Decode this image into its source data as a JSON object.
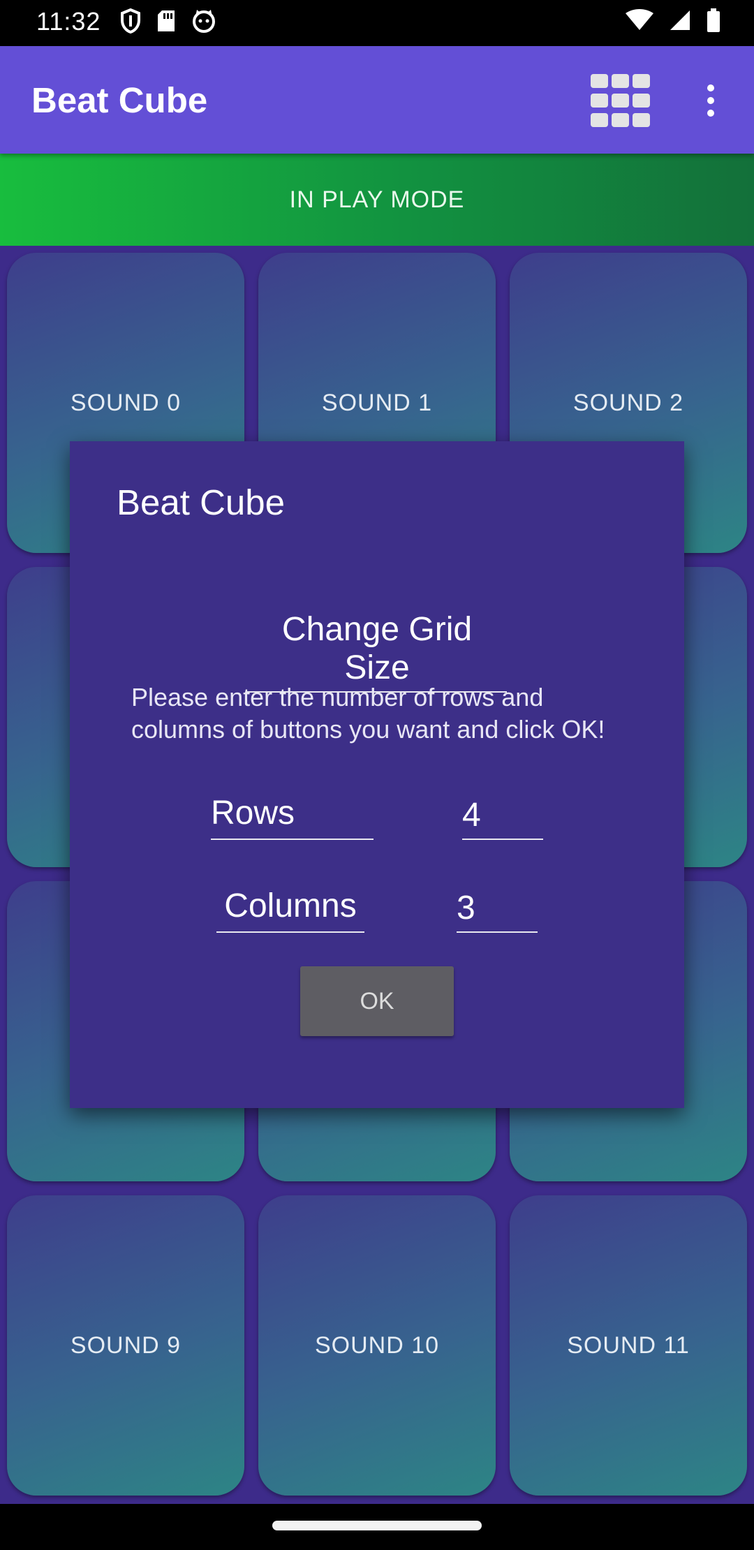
{
  "status_bar": {
    "time": "11:32",
    "left_icons": [
      "vpn-shield-icon",
      "sd-card-icon",
      "cat-notification-icon"
    ],
    "right_icons": [
      "wifi-icon",
      "signal-icon",
      "battery-icon"
    ]
  },
  "app_bar": {
    "title": "Beat Cube",
    "actions": [
      "grid-size-icon",
      "more-vert-icon"
    ]
  },
  "mode_banner": {
    "text": "IN PLAY MODE"
  },
  "pads": [
    {
      "label": "SOUND 0"
    },
    {
      "label": "SOUND 1"
    },
    {
      "label": "SOUND 2"
    },
    {
      "label": ""
    },
    {
      "label": ""
    },
    {
      "label": ""
    },
    {
      "label": ""
    },
    {
      "label": ""
    },
    {
      "label": ""
    },
    {
      "label": "SOUND 9"
    },
    {
      "label": "SOUND 10"
    },
    {
      "label": "SOUND 11"
    }
  ],
  "dialog": {
    "title": "Beat Cube",
    "heading": "Change Grid Size",
    "message": "Please enter the number of rows and columns of buttons you want and click OK!",
    "rows_label": "Rows",
    "rows_value": "4",
    "columns_label": "Columns",
    "columns_value": "3",
    "ok_label": "OK"
  },
  "colors": {
    "app_bar": "#634fd6",
    "banner_start": "#18bd3e",
    "banner_end": "#13703a",
    "background": "#3d2b8a",
    "dialog": "#3d2f88"
  }
}
